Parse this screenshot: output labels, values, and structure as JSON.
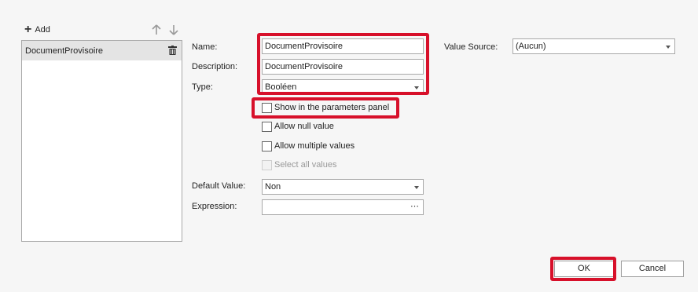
{
  "toolbar": {
    "add_label": "Add"
  },
  "parameters": {
    "items": [
      {
        "label": "DocumentProvisoire"
      }
    ]
  },
  "form": {
    "name_label": "Name:",
    "name_value": "DocumentProvisoire",
    "description_label": "Description:",
    "description_value": "DocumentProvisoire",
    "type_label": "Type:",
    "type_value": "Booléen",
    "value_source_label": "Value Source:",
    "value_source_value": "(Aucun)",
    "checkboxes": [
      {
        "label": "Show in the parameters panel",
        "checked": false,
        "enabled": true
      },
      {
        "label": "Allow null value",
        "checked": false,
        "enabled": true
      },
      {
        "label": "Allow multiple values",
        "checked": false,
        "enabled": true
      },
      {
        "label": "Select all values",
        "checked": false,
        "enabled": false
      }
    ],
    "default_value_label": "Default Value:",
    "default_value_value": "Non",
    "expression_label": "Expression:",
    "expression_value": "",
    "expression_button": "⋯"
  },
  "buttons": {
    "ok": "OK",
    "cancel": "Cancel"
  },
  "colors": {
    "highlight": "#d7102a",
    "selected_row": "#e4e4e4"
  }
}
